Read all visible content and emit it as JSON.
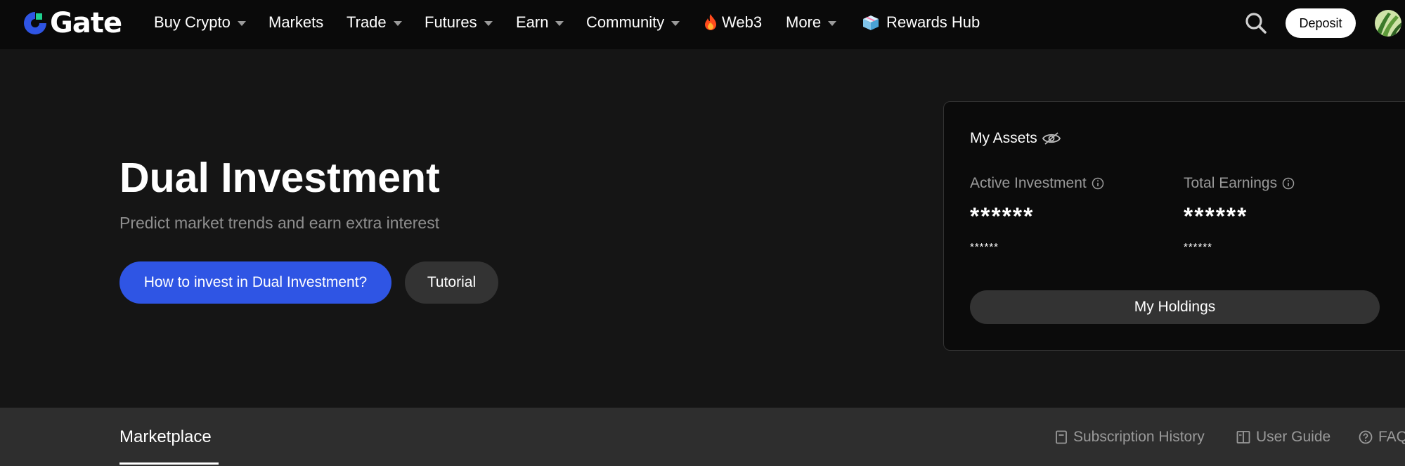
{
  "brand": {
    "name": "Gate",
    "accent_blue": "#2f55e4",
    "accent_green": "#1fd18f"
  },
  "nav": {
    "items": [
      {
        "label": "Buy Crypto",
        "has_dropdown": true
      },
      {
        "label": "Markets",
        "has_dropdown": false
      },
      {
        "label": "Trade",
        "has_dropdown": true
      },
      {
        "label": "Futures",
        "has_dropdown": true
      },
      {
        "label": "Earn",
        "has_dropdown": true
      },
      {
        "label": "Community",
        "has_dropdown": true
      },
      {
        "label": "Web3",
        "icon": "fire-icon",
        "has_dropdown": false
      },
      {
        "label": "More",
        "has_dropdown": true
      },
      {
        "label": "Rewards Hub",
        "icon": "gift-box-icon",
        "has_dropdown": false
      }
    ],
    "search_icon": "search-icon",
    "deposit_label": "Deposit",
    "avatar_icon": "user-avatar"
  },
  "hero": {
    "title": "Dual Investment",
    "subtitle": "Predict market trends and earn extra interest",
    "primary_button": "How to invest in Dual Investment?",
    "secondary_button": "Tutorial"
  },
  "assets": {
    "title": "My Assets",
    "visibility_icon": "eye-off-icon",
    "active_investment": {
      "label": "Active Investment",
      "value": "******",
      "sub_value": "******"
    },
    "total_earnings": {
      "label": "Total Earnings",
      "value": "******",
      "sub_value": "******"
    },
    "holdings_button": "My Holdings"
  },
  "subnav": {
    "tab": "Marketplace",
    "links": [
      {
        "label": "Subscription History",
        "icon": "document-icon"
      },
      {
        "label": "User Guide",
        "icon": "book-icon"
      },
      {
        "label": "FAQ",
        "icon": "help-circle-icon"
      }
    ]
  }
}
